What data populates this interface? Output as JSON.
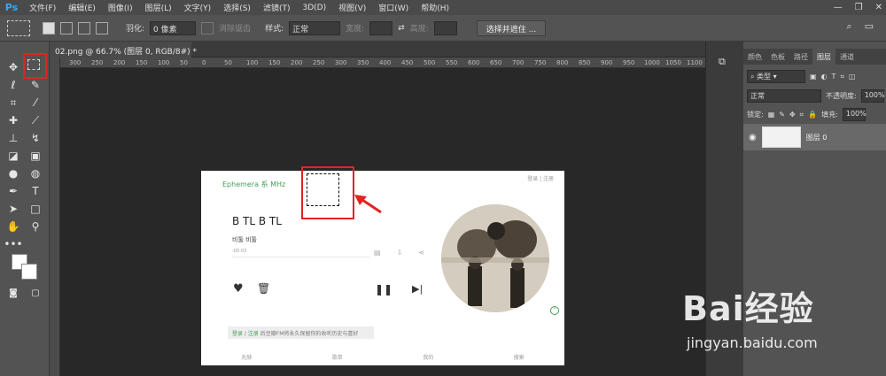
{
  "app": {
    "logo": "Ps"
  },
  "menu": [
    "文件(F)",
    "编辑(E)",
    "图像(I)",
    "图层(L)",
    "文字(Y)",
    "选择(S)",
    "滤镜(T)",
    "3D(D)",
    "视图(V)",
    "窗口(W)",
    "帮助(H)"
  ],
  "options": {
    "feather_label": "羽化:",
    "feather_value": "0 像素",
    "antialias_label": "消除锯齿",
    "style_label": "样式:",
    "style_value": "正常",
    "width_label": "宽度:",
    "height_label": "高度:",
    "select_mask_button": "选择并遮住 ..."
  },
  "document": {
    "tab_title": "02.png @ 66.7% (图层 0, RGB/8#) *",
    "ruler_labels": [
      "300",
      "250",
      "200",
      "150",
      "100",
      "50",
      "0",
      "50",
      "100",
      "150",
      "200",
      "250",
      "300",
      "350",
      "400",
      "450",
      "500",
      "550",
      "600",
      "650",
      "700",
      "750",
      "800",
      "850",
      "900",
      "950",
      "1000",
      "1050",
      "1100"
    ]
  },
  "canvas": {
    "logo_text": "Ephemera 系 MHz",
    "login_links": "登录  |  注册",
    "song_title": "B TL B TL",
    "artist": "비툴 비툴",
    "time": "-05:03",
    "banner_login": "登录",
    "banner_sep": " / ",
    "banner_register": "注册",
    "banner_text": " 后豆瓣FM将永久保留你的收听历史与喜好",
    "nav_items": [
      "兆赫",
      "歌单",
      "我的",
      "搜索"
    ]
  },
  "panel": {
    "tabs": [
      "颜色",
      "色板",
      "路径",
      "图层",
      "通道"
    ],
    "active_tab": "图层",
    "filter_label": "类型",
    "blend_mode": "正常",
    "opacity_label": "不透明度:",
    "opacity_value": "100%",
    "lock_label": "锁定:",
    "fill_label": "填充:",
    "fill_value": "100%",
    "layer_name": "图层 0"
  },
  "watermark": {
    "brand": "Bai经验",
    "url": "jingyan.baidu.com"
  },
  "colors": {
    "highlight": "#e52222",
    "brand_green": "#45a05a",
    "ps_blue": "#31a8ff"
  }
}
